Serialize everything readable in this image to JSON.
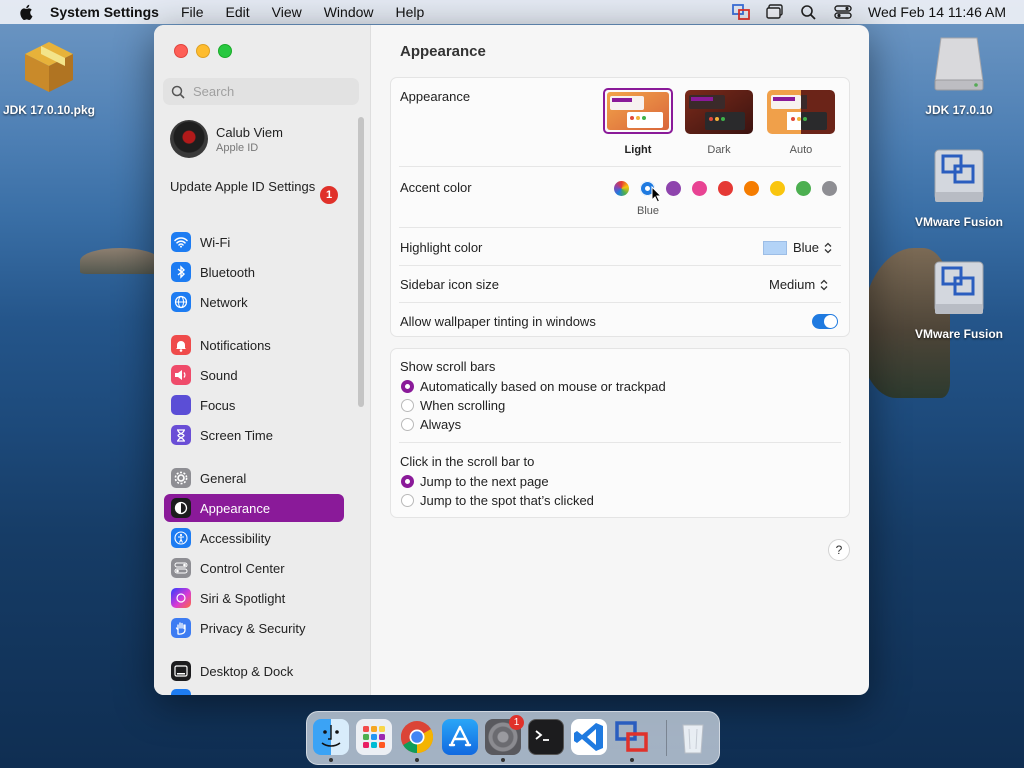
{
  "menubar": {
    "app_name": "System Settings",
    "items": [
      "File",
      "Edit",
      "View",
      "Window",
      "Help"
    ],
    "clock": "Wed Feb 14  11:46 AM"
  },
  "desktop": {
    "icons": [
      {
        "label": "JDK 17.0.10.pkg"
      },
      {
        "label": "JDK 17.0.10"
      },
      {
        "label": "VMware Fusion"
      },
      {
        "label": "VMware Fusion"
      }
    ]
  },
  "sidebar": {
    "search_placeholder": "Search",
    "profile": {
      "name": "Calub Viem",
      "subtitle": "Apple ID"
    },
    "update_label": "Update Apple ID Settings",
    "update_badge": "1",
    "items": [
      {
        "label": "Wi-Fi",
        "color": "#1d7cf2"
      },
      {
        "label": "Bluetooth",
        "color": "#1d7cf2"
      },
      {
        "label": "Network",
        "color": "#1d7cf2"
      },
      {
        "label": "Notifications",
        "color": "#ef4b4b"
      },
      {
        "label": "Sound",
        "color": "#ef4b6a"
      },
      {
        "label": "Focus",
        "color": "#5b4ed6"
      },
      {
        "label": "Screen Time",
        "color": "#6a4ed6"
      },
      {
        "label": "General",
        "color": "#8e8e93"
      },
      {
        "label": "Appearance",
        "color": "#1c1c1e"
      },
      {
        "label": "Accessibility",
        "color": "#1d7cf2"
      },
      {
        "label": "Control Center",
        "color": "#8e8e93"
      },
      {
        "label": "Siri & Spotlight",
        "color": "#b04be0"
      },
      {
        "label": "Privacy & Security",
        "color": "#3d7cf2"
      },
      {
        "label": "Desktop & Dock",
        "color": "#1c1c1e"
      }
    ]
  },
  "main": {
    "title": "Appearance",
    "appearance": {
      "label": "Appearance",
      "options": [
        "Light",
        "Dark",
        "Auto"
      ],
      "selected": "Light"
    },
    "accent": {
      "label": "Accent color",
      "colors": [
        "#8e8e93",
        "#1f7ae0",
        "#8e44ad",
        "#e84393",
        "#e53935",
        "#f57c00",
        "#f9c50e",
        "#4caf50",
        "#8e8e93"
      ],
      "selected_name": "Blue"
    },
    "highlight": {
      "label": "Highlight color",
      "value": "Blue",
      "swatch": "#b3d3f7"
    },
    "sidebar_icon": {
      "label": "Sidebar icon size",
      "value": "Medium"
    },
    "wallpaper_tint": {
      "label": "Allow wallpaper tinting in windows",
      "on": true
    },
    "scroll_bars": {
      "label": "Show scroll bars",
      "options": [
        "Automatically based on mouse or trackpad",
        "When scrolling",
        "Always"
      ],
      "selected_index": 0
    },
    "click_scroll": {
      "label": "Click in the scroll bar to",
      "options": [
        "Jump to the next page",
        "Jump to the spot that’s clicked"
      ],
      "selected_index": 0
    },
    "help": "?"
  },
  "dock": {
    "apps": [
      "finder-icon",
      "launchpad-icon",
      "chrome-icon",
      "app-store-icon",
      "system-settings-icon",
      "terminal-icon",
      "vscode-icon",
      "vmware-fusion-icon",
      "trash-icon"
    ],
    "settings_badge": "1"
  }
}
